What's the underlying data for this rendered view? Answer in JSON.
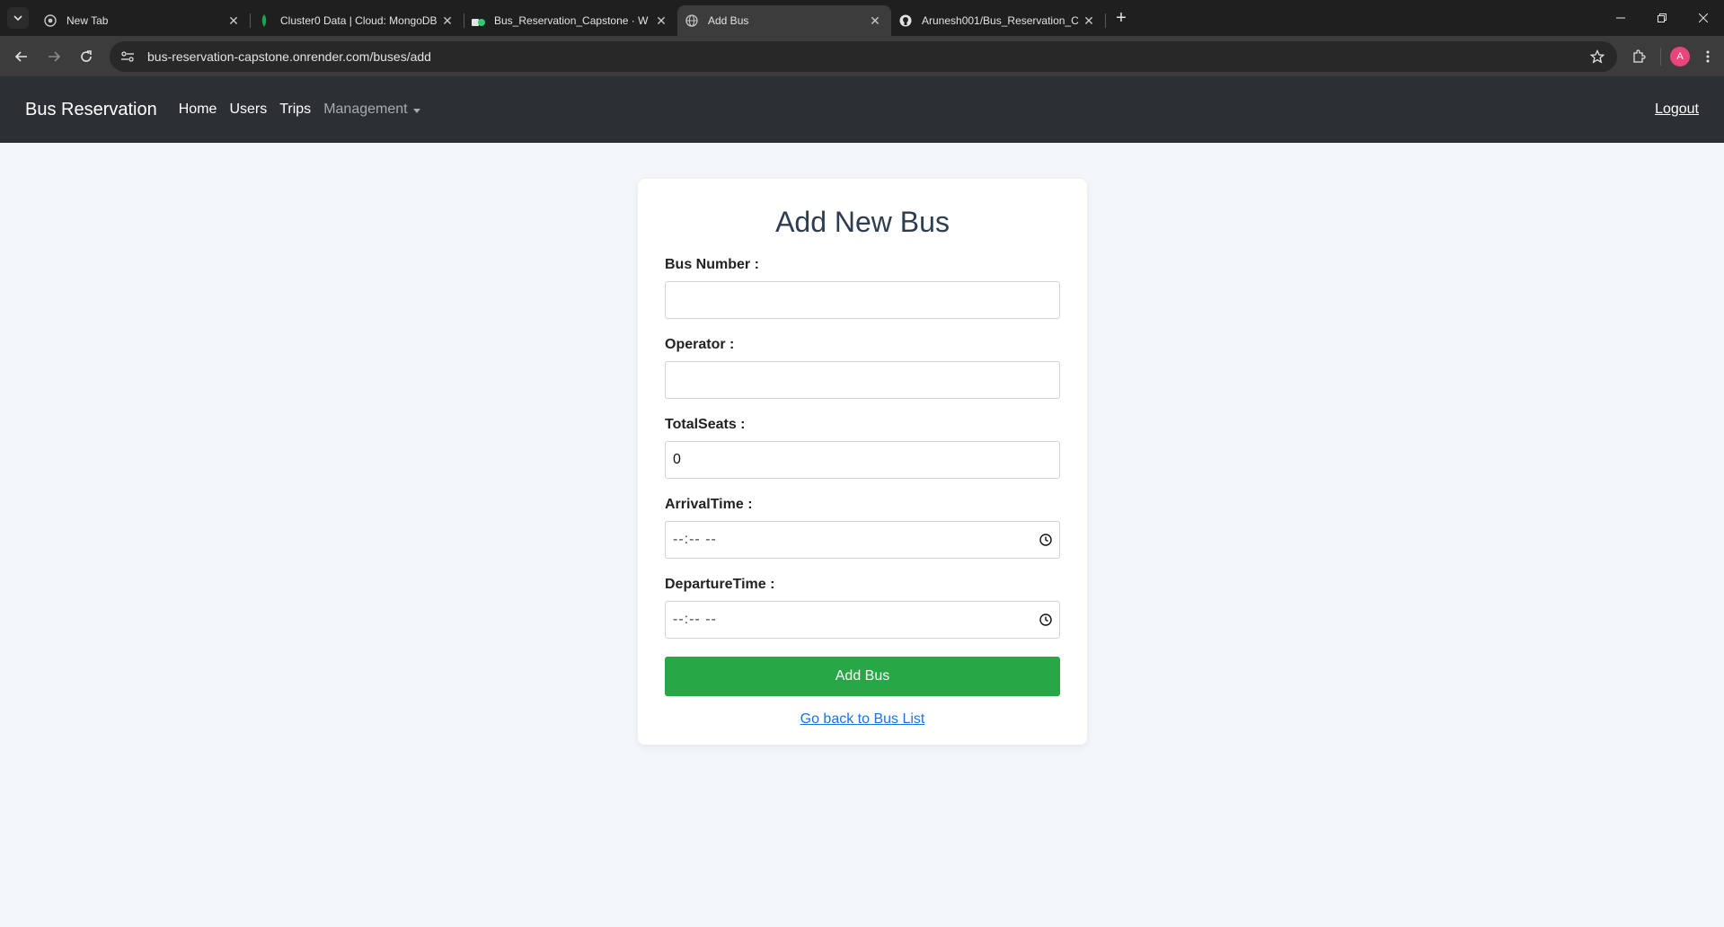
{
  "browser": {
    "tabs": [
      {
        "title": "New Tab",
        "icon": "chrome-icon",
        "active": false
      },
      {
        "title": "Cluster0 Data | Cloud: MongoDB",
        "icon": "mongodb-leaf-icon",
        "active": false
      },
      {
        "title": "Bus_Reservation_Capstone · W",
        "icon": "render-icon",
        "active": false
      },
      {
        "title": "Add Bus",
        "icon": "globe-icon",
        "active": true
      },
      {
        "title": "Arunesh001/Bus_Reservation_C",
        "icon": "github-icon",
        "active": false
      }
    ],
    "url": "bus-reservation-capstone.onrender.com/buses/add",
    "profile_initial": "A"
  },
  "navbar": {
    "brand": "Bus Reservation",
    "links": [
      "Home",
      "Users",
      "Trips"
    ],
    "dropdown": "Management",
    "logout": "Logout"
  },
  "form": {
    "title": "Add New Bus",
    "fields": {
      "bus_number": {
        "label": "Bus Number :",
        "value": ""
      },
      "operator": {
        "label": "Operator :",
        "value": ""
      },
      "total_seats": {
        "label": "TotalSeats :",
        "value": "0"
      },
      "arrival_time": {
        "label": "ArrivalTime :",
        "value": "--:-- --"
      },
      "departure_time": {
        "label": "DepartureTime :",
        "value": "--:-- --"
      }
    },
    "submit_label": "Add Bus",
    "back_link": "Go back to Bus List"
  },
  "colors": {
    "navbar_bg": "#2c3034",
    "submit_green": "#28a745",
    "link_blue": "#1a73e8",
    "page_bg": "#f4f7fa"
  }
}
